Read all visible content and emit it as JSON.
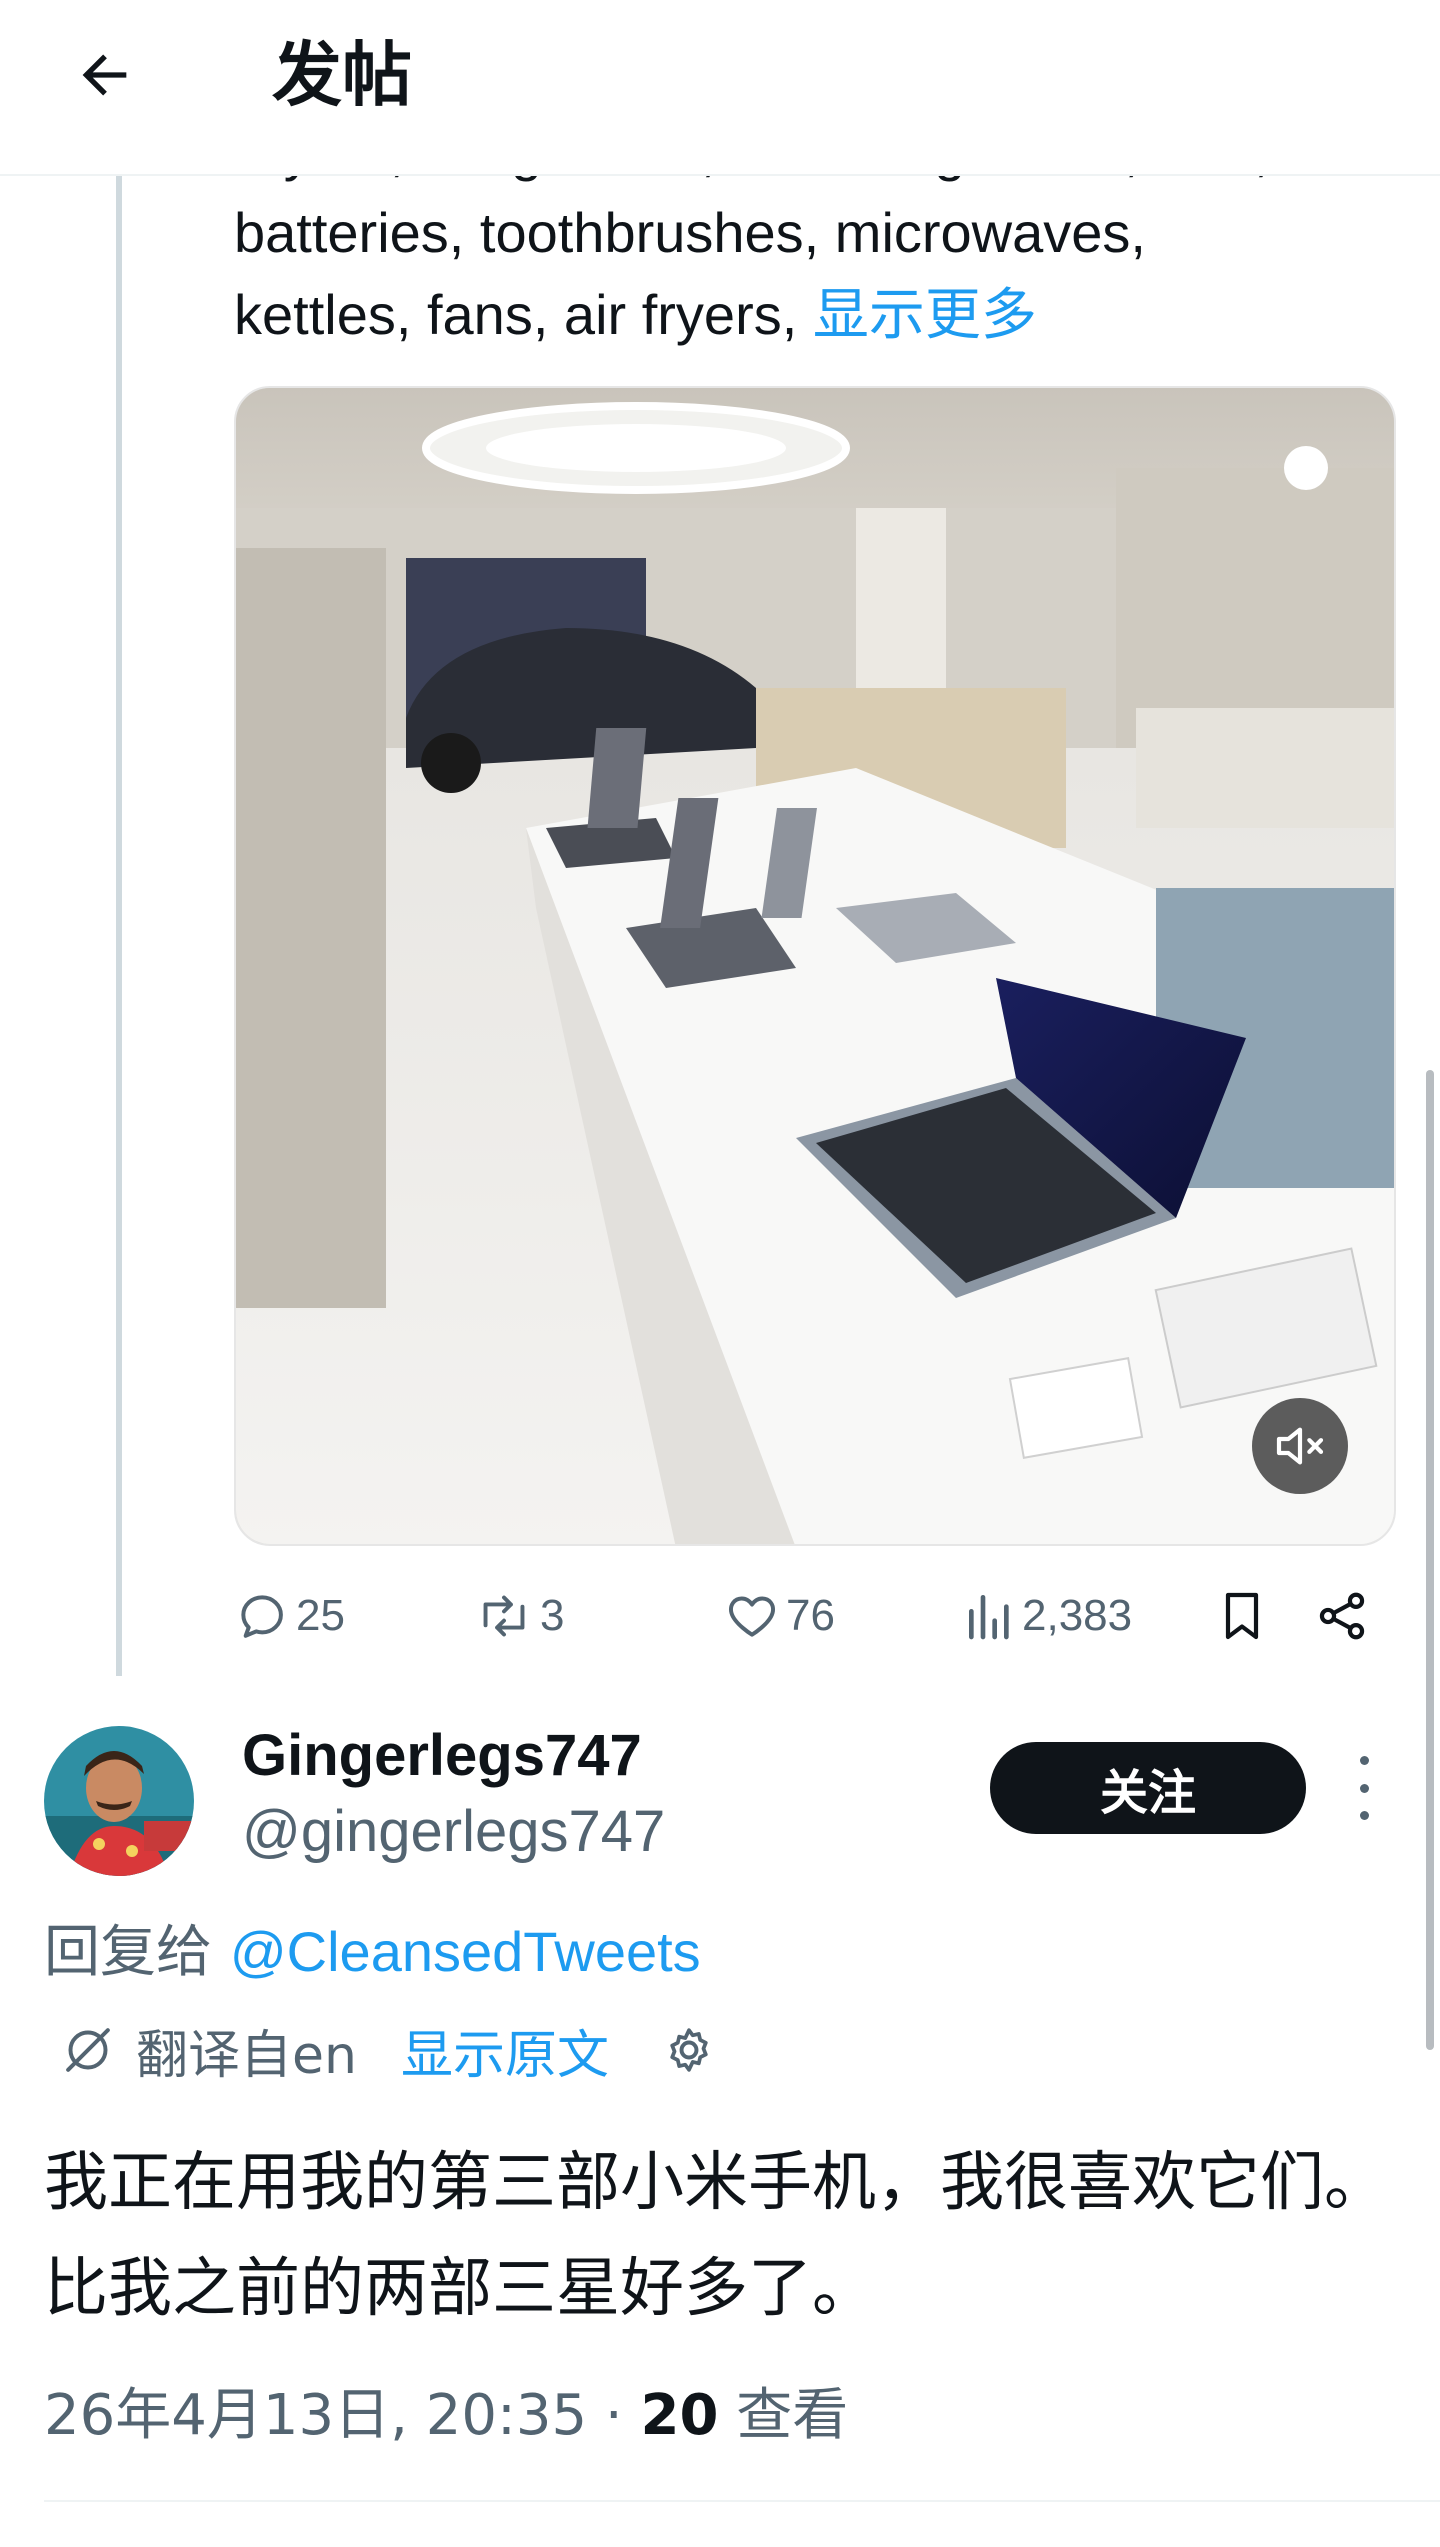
{
  "header": {
    "title": "发帖"
  },
  "tweet": {
    "text_lines": [
      "dryers, sunglasses, camera glasses, TVs,",
      "batteries, toothbrushes, microwaves,"
    ],
    "last_line_text": "kettles, fans, air fryers, ",
    "show_more": "显示更多",
    "media": {
      "type": "video",
      "description_icon": "mute-icon"
    },
    "actions": {
      "replies": "25",
      "retweets": "3",
      "likes": "76",
      "views": "2,383"
    }
  },
  "reply": {
    "display_name": "Gingerlegs747",
    "handle": "@gingerlegs747",
    "follow_label": "关注",
    "reply_to_prefix": "回复给 ",
    "reply_to_mention": "@CleansedTweets",
    "translated_from": "翻译自en",
    "show_original": "显示原文",
    "body": "我正在用我的第三部小米手机，我很喜欢它们。比我之前的两部三星好多了。",
    "timestamp": "26年4月13日, 20:35 · ",
    "views_count": "20",
    "views_label": " 查看"
  },
  "colors": {
    "accent": "#1d9bf0",
    "text_primary": "#0f1419",
    "text_secondary": "#536471",
    "follow_bg": "#0f1419"
  }
}
